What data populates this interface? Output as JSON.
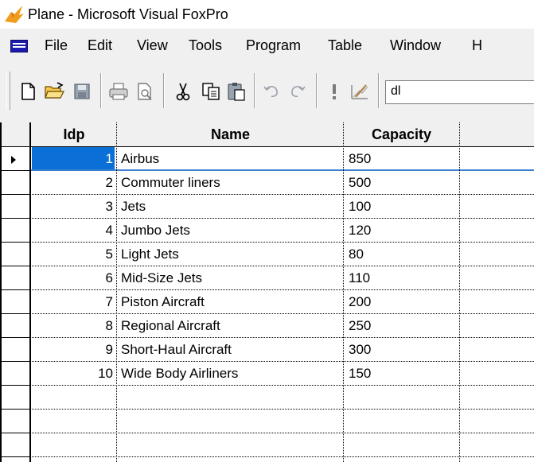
{
  "window": {
    "title": "Plane - Microsoft Visual FoxPro"
  },
  "menu": {
    "items": [
      "File",
      "Edit",
      "View",
      "Tools",
      "Program",
      "Table",
      "Window",
      "H"
    ]
  },
  "toolbar": {
    "buttons": [
      "new-icon",
      "open-icon",
      "save-icon",
      "print-icon",
      "print-preview-icon",
      "cut-icon",
      "copy-icon",
      "paste-icon",
      "undo-icon",
      "redo-icon",
      "run-icon",
      "modify-form-icon"
    ],
    "combo_value": "dl"
  },
  "grid": {
    "columns": [
      "Idp",
      "Name",
      "Capacity"
    ],
    "rows": [
      {
        "idp": "1",
        "name": "Airbus",
        "capacity": "850"
      },
      {
        "idp": "2",
        "name": "Commuter liners",
        "capacity": "500"
      },
      {
        "idp": "3",
        "name": "Jets",
        "capacity": "100"
      },
      {
        "idp": "4",
        "name": "Jumbo Jets",
        "capacity": "120"
      },
      {
        "idp": "5",
        "name": "Light Jets",
        "capacity": "80"
      },
      {
        "idp": "6",
        "name": "Mid-Size Jets",
        "capacity": "110"
      },
      {
        "idp": "7",
        "name": "Piston Aircraft",
        "capacity": "200"
      },
      {
        "idp": "8",
        "name": "Regional Aircraft",
        "capacity": "250"
      },
      {
        "idp": "9",
        "name": "Short-Haul Aircraft",
        "capacity": "300"
      },
      {
        "idp": "10",
        "name": "Wide Body Airliners",
        "capacity": "150"
      }
    ],
    "selected_row": 0,
    "colors": {
      "selection": "#0a6fd6",
      "header_bg": "#f0f0f0"
    }
  }
}
